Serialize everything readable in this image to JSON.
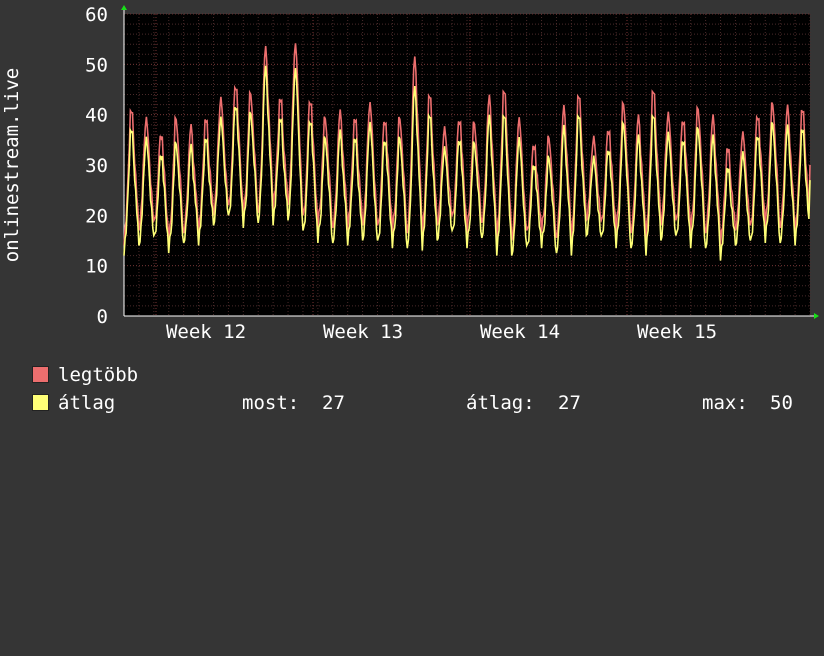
{
  "chart_data": {
    "type": "line",
    "ylabel": "onlinestream.live",
    "ylim": [
      0,
      60
    ],
    "yticks": [
      0,
      10,
      20,
      30,
      40,
      50,
      60
    ],
    "x_ticks": [
      "Week 12",
      "Week 13",
      "Week 14",
      "Week 15"
    ],
    "grid": true,
    "colors": {
      "background": "#353535",
      "plot_bg": "#000000",
      "grid": "#4a2a2a",
      "series_max": "#ec6e6e",
      "series_avg": "#ffff77",
      "axis_arrow": "#18e018"
    },
    "series": [
      {
        "name": "legtöbb",
        "daily_peaks": [
          42,
          40,
          37,
          40,
          38,
          40,
          44,
          47,
          45,
          54,
          44,
          55,
          44,
          40,
          41,
          40,
          43,
          40,
          40,
          52,
          45,
          38,
          40,
          39,
          44,
          46,
          40,
          35,
          36,
          42,
          45,
          36,
          38,
          43,
          40,
          46,
          41,
          40,
          42,
          40,
          34,
          37,
          41,
          43,
          42,
          42
        ],
        "daily_troughs": [
          15,
          17,
          18,
          15,
          16,
          17,
          20,
          21,
          20,
          20,
          22,
          22,
          19,
          18,
          17,
          18,
          18,
          17,
          17,
          16,
          17,
          18,
          19,
          17,
          18,
          16,
          15,
          16,
          17,
          15,
          16,
          19,
          18,
          17,
          16,
          16,
          18,
          18,
          17,
          16,
          15,
          17,
          17,
          18,
          17,
          17
        ],
        "last": 30
      },
      {
        "name": "átlag",
        "daily_peaks": [
          38,
          36,
          33,
          35,
          34,
          36,
          40,
          43,
          41,
          50,
          40,
          50,
          40,
          36,
          37,
          36,
          39,
          36,
          36,
          46,
          41,
          34,
          36,
          35,
          40,
          41,
          36,
          31,
          32,
          38,
          41,
          32,
          34,
          39,
          36,
          41,
          37,
          36,
          38,
          36,
          30,
          33,
          37,
          39,
          38,
          38
        ],
        "daily_troughs": [
          13,
          14,
          15,
          13,
          14,
          15,
          18,
          19,
          18,
          18,
          19,
          19,
          16,
          15,
          14,
          15,
          15,
          14,
          14,
          13,
          14,
          15,
          16,
          14,
          15,
          13,
          12,
          13,
          14,
          12,
          13,
          16,
          15,
          14,
          13,
          13,
          15,
          15,
          14,
          13,
          12,
          14,
          14,
          15,
          14,
          15
        ],
        "last": 27
      }
    ]
  },
  "legend": {
    "max_label": "legtöbb",
    "avg_label": "átlag",
    "stats": {
      "now_label": "most:",
      "now_value": "27",
      "avg_label": "átlag:",
      "avg_value": "27",
      "max_label": "max:",
      "max_value": "50"
    }
  }
}
